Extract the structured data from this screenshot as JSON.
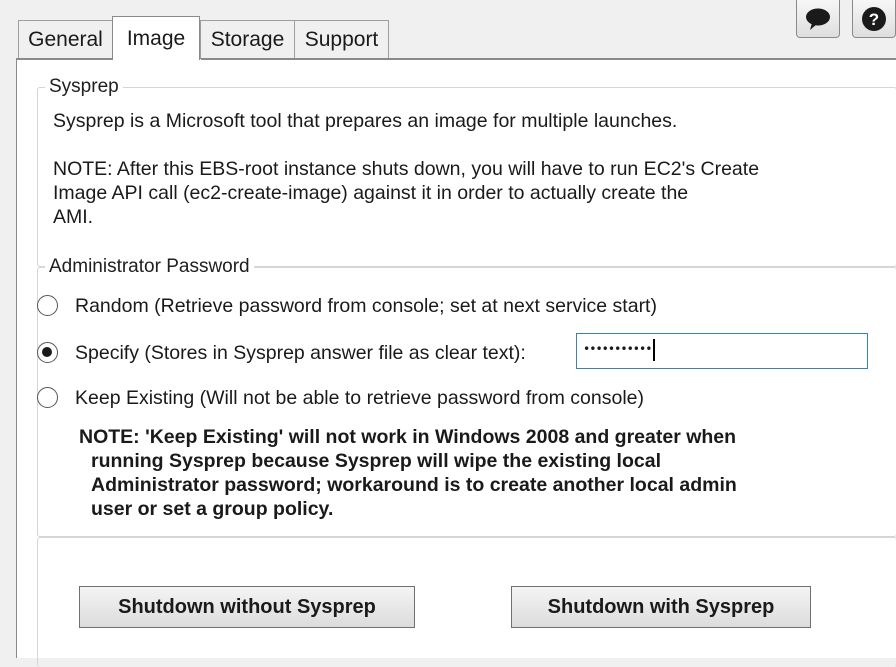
{
  "tabs": [
    {
      "label": "General"
    },
    {
      "label": "Image"
    },
    {
      "label": "Storage"
    },
    {
      "label": "Support"
    }
  ],
  "active_tab": "Image",
  "corner_icons": [
    "speech-bubble-icon",
    "help-icon"
  ],
  "help_glyph": "?",
  "sysprep": {
    "legend": "Sysprep",
    "description": "Sysprep is a Microsoft tool that prepares an image for multiple launches.",
    "note_lines": [
      "NOTE: After this EBS-root instance shuts down, you will have to run EC2's Create",
      "Image API call (ec2-create-image) against it in order to actually create the",
      "AMI."
    ]
  },
  "admin_password": {
    "legend": "Administrator Password",
    "options": [
      {
        "label": "Random (Retrieve password from console; set at next service start)",
        "selected": false
      },
      {
        "label": "Specify (Stores in Sysprep answer file as clear text):",
        "selected": true
      },
      {
        "label": "Keep Existing (Will not be able to retrieve password from console)",
        "selected": false
      }
    ],
    "password_value": "•••••••••••",
    "warning_lines": [
      "NOTE: 'Keep Existing' will not work in Windows 2008 and greater when",
      "running Sysprep because Sysprep will wipe the existing local",
      "Administrator password; workaround is to create another local admin",
      "user or set a group policy."
    ]
  },
  "buttons": {
    "shutdown_without": "Shutdown without Sysprep",
    "shutdown_with": "Shutdown with Sysprep"
  }
}
